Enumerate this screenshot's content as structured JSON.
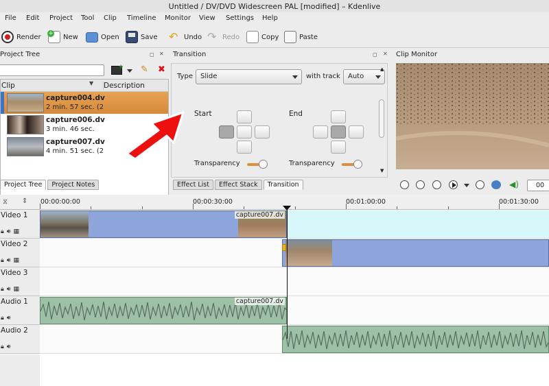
{
  "window": {
    "title": "Untitled / DV/DVD Widescreen PAL [modified] – Kdenlive"
  },
  "menu": [
    "File",
    "Edit",
    "Project",
    "Tool",
    "Clip",
    "Timeline",
    "Monitor",
    "View",
    "Settings",
    "Help"
  ],
  "toolbar": {
    "render": "Render",
    "new": "New",
    "open": "Open",
    "save": "Save",
    "undo": "Undo",
    "redo": "Redo",
    "copy": "Copy",
    "paste": "Paste"
  },
  "project_tree": {
    "title": "Project Tree",
    "columns": {
      "clip": "Clip",
      "description": "Description"
    },
    "clips": [
      {
        "name": "capture004.dv",
        "duration": "2 min. 57 sec. (2"
      },
      {
        "name": "capture006.dv",
        "duration": "3 min. 46 sec."
      },
      {
        "name": "capture007.dv",
        "duration": "4 min. 51 sec. (2"
      }
    ],
    "tabs": {
      "tree": "Project Tree",
      "notes": "Project Notes"
    }
  },
  "transition": {
    "title": "Transition",
    "type_label": "Type",
    "type_value": "Slide",
    "with_track_label": "with track",
    "with_track_value": "Auto",
    "start_label": "Start",
    "end_label": "End",
    "transparency_label": "Transparency",
    "tabs": {
      "effect_list": "Effect List",
      "effect_stack": "Effect Stack",
      "transition": "Transition"
    }
  },
  "clip_monitor": {
    "title": "Clip Monitor",
    "timecode": "00"
  },
  "timeline": {
    "ruler": [
      "00:00:00:00",
      "00:00:30:00",
      "00:01:00:00",
      "00:01:30:00"
    ],
    "tracks": [
      {
        "name": "Video 1"
      },
      {
        "name": "Video 2"
      },
      {
        "name": "Video 3"
      },
      {
        "name": "Audio 1"
      },
      {
        "name": "Audio 2"
      }
    ],
    "clip_labels": {
      "video1_clip": "capture007.dv",
      "audio1_clip": "capture007.dv"
    }
  },
  "colors": {
    "selection": "#d88f3f",
    "video_clip": "#8ea5db",
    "audio_clip": "#9dc1a7",
    "transition_lane": "#d6f8fb"
  }
}
